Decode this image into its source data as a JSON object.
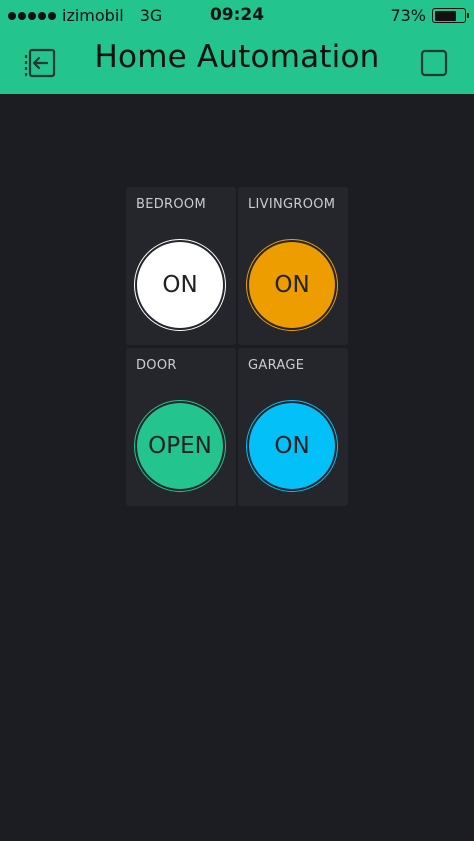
{
  "status_bar": {
    "carrier": "izimobil",
    "network": "3G",
    "time": "09:24",
    "battery_percent_label": "73%",
    "battery_level": 0.73
  },
  "header": {
    "title": "Home Automation",
    "left_icon": "exit-icon",
    "right_icon": "square-icon"
  },
  "colors": {
    "header_bg": "#23c48e",
    "page_bg": "#1b1d22",
    "widget_bg": "#24262c"
  },
  "widgets": [
    {
      "label": "BEDROOM",
      "state": "ON",
      "color": "#ffffff"
    },
    {
      "label": "LIVINGROOM",
      "state": "ON",
      "color": "#ee9d00"
    },
    {
      "label": "DOOR",
      "state": "OPEN",
      "color": "#23c48e"
    },
    {
      "label": "GARAGE",
      "state": "ON",
      "color": "#04c0f8"
    }
  ]
}
